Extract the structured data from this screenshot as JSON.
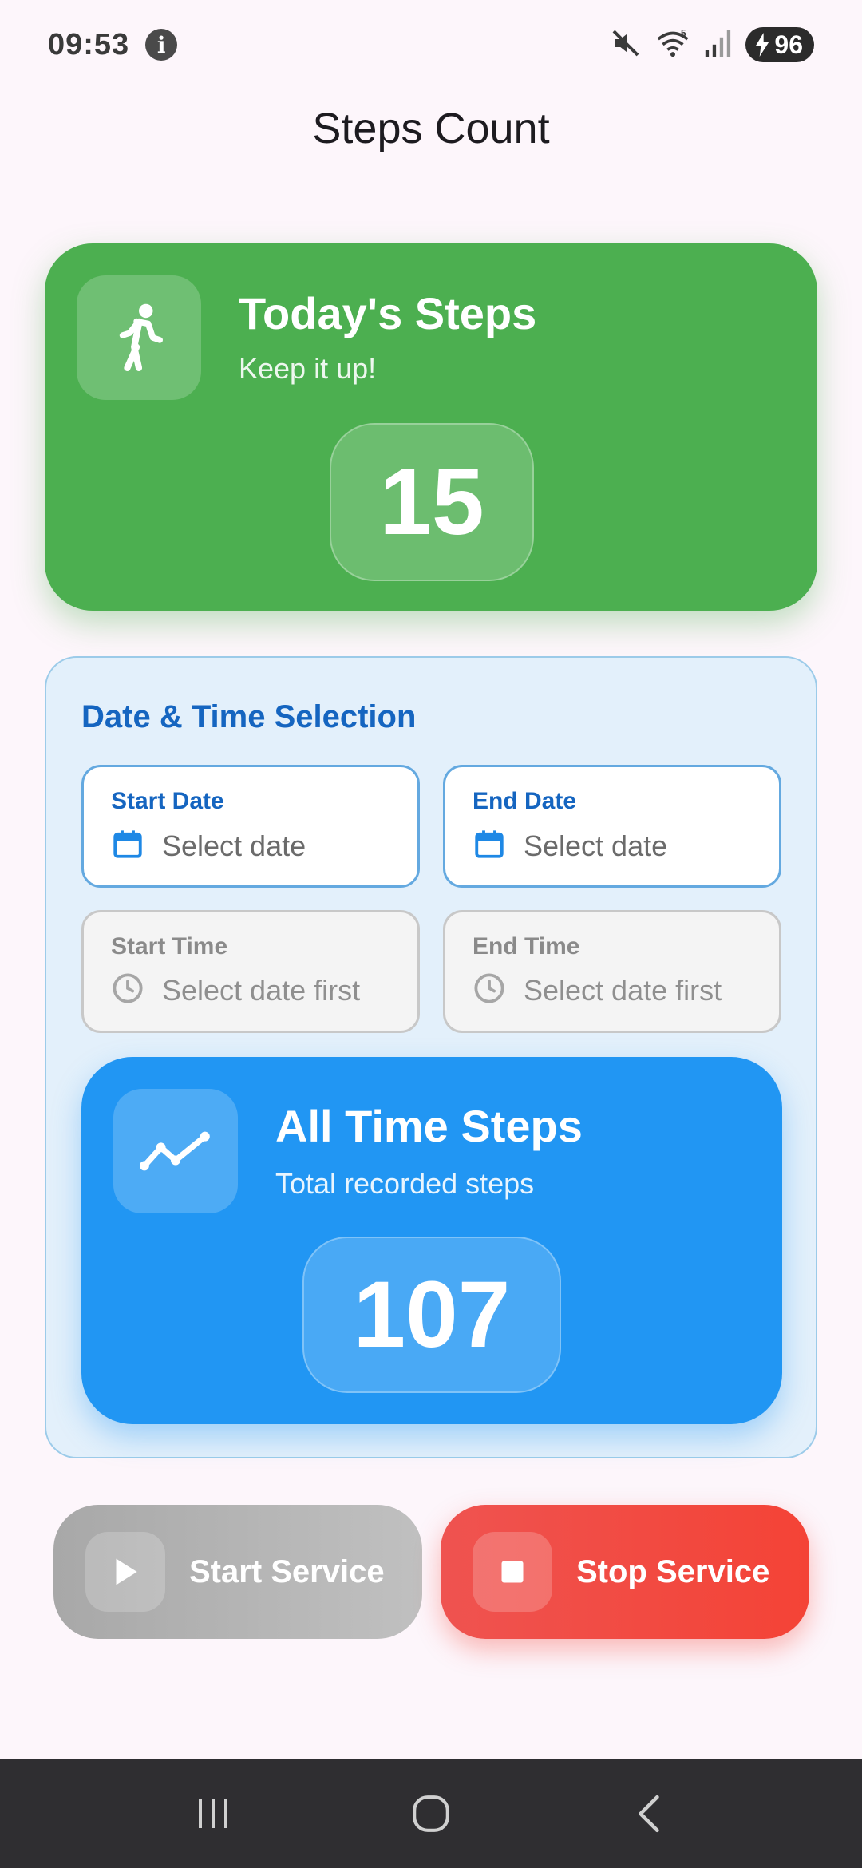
{
  "status_bar": {
    "time": "09:53",
    "info_glyph": "i",
    "battery": "96",
    "icons": [
      "mute-icon",
      "wifi-icon",
      "signal-icon",
      "battery-charging-icon"
    ]
  },
  "app": {
    "title": "Steps Count"
  },
  "today_card": {
    "title": "Today's Steps",
    "subtitle": "Keep it up!",
    "count": "15",
    "icon": "walking-person-icon",
    "color": "#4caf50"
  },
  "date_time": {
    "heading": "Date & Time Selection",
    "start_date": {
      "label": "Start Date",
      "value": "Select date",
      "icon": "calendar-icon"
    },
    "end_date": {
      "label": "End Date",
      "value": "Select date",
      "icon": "calendar-icon"
    },
    "start_time": {
      "label": "Start Time",
      "value": "Select date first",
      "icon": "clock-icon"
    },
    "end_time": {
      "label": "End Time",
      "value": "Select date first",
      "icon": "clock-icon"
    }
  },
  "alltime_card": {
    "title": "All Time Steps",
    "subtitle": "Total recorded steps",
    "count": "107",
    "icon": "trending-line-icon",
    "color": "#2196f3"
  },
  "actions": {
    "start_label": "Start Service",
    "stop_label": "Stop Service",
    "start_icon": "play-icon",
    "stop_icon": "stop-icon"
  },
  "nav": {
    "items": [
      "recent-apps-icon",
      "home-icon",
      "back-icon"
    ]
  }
}
